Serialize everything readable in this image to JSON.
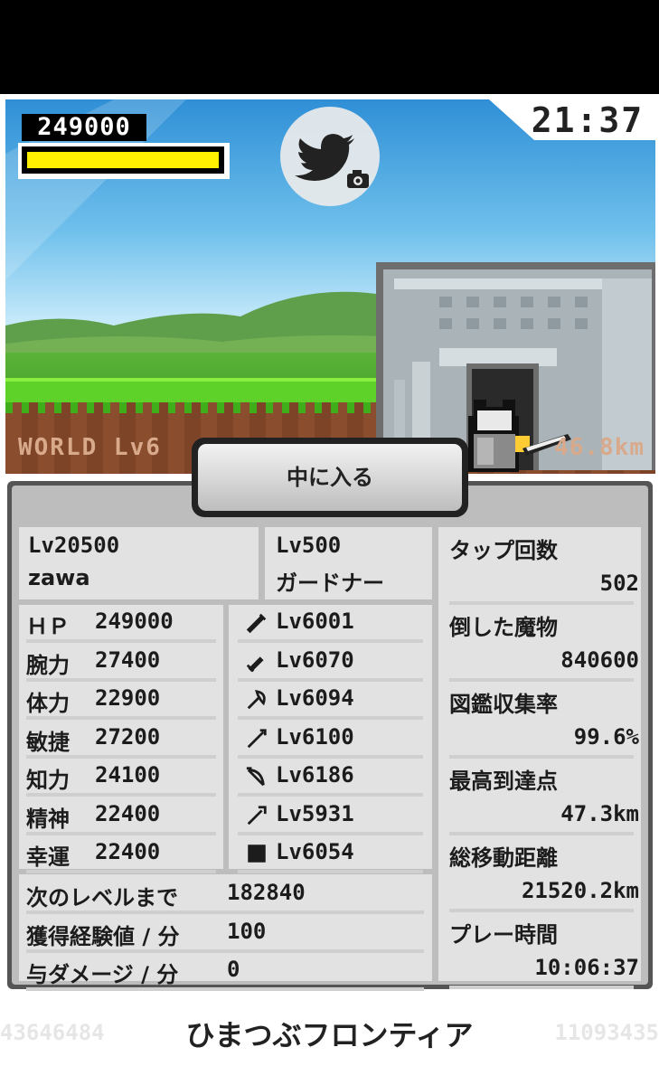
{
  "hud": {
    "score": "249000",
    "hp_fraction": 1.0,
    "clock": "21:37",
    "world_level": "WORLD Lv6",
    "distance": "46.8km",
    "enter_button": "中に入る"
  },
  "player": {
    "level": "Lv20500",
    "name": "zawa"
  },
  "job": {
    "level": "Lv500",
    "name": "ガードナー"
  },
  "stats": [
    {
      "label": "ＨＰ",
      "value": "249000"
    },
    {
      "label": "腕力",
      "value": "27400"
    },
    {
      "label": "体力",
      "value": "22900"
    },
    {
      "label": "敏捷",
      "value": "27200"
    },
    {
      "label": "知力",
      "value": "24100"
    },
    {
      "label": "精神",
      "value": "22400"
    },
    {
      "label": "幸運",
      "value": "22400"
    }
  ],
  "weapons": [
    {
      "icon": "sword-icon",
      "level": "Lv6001"
    },
    {
      "icon": "dagger-icon",
      "level": "Lv6070"
    },
    {
      "icon": "axe-icon",
      "level": "Lv6094"
    },
    {
      "icon": "spear-icon",
      "level": "Lv6100"
    },
    {
      "icon": "bow-icon",
      "level": "Lv6186"
    },
    {
      "icon": "staff-icon",
      "level": "Lv5931"
    },
    {
      "icon": "shield-icon",
      "level": "Lv6054"
    }
  ],
  "progress": [
    {
      "label": "次のレベルまで",
      "value": "182840"
    },
    {
      "label": "獲得経験値 / 分",
      "value": "100"
    },
    {
      "label": "与ダメージ / 分",
      "value": "0"
    }
  ],
  "records": [
    {
      "label": "タップ回数",
      "value": "502"
    },
    {
      "label": "倒した魔物",
      "value": "840600"
    },
    {
      "label": "図鑑収集率",
      "value": "99.6%"
    },
    {
      "label": "最高到達点",
      "value": "47.3km"
    },
    {
      "label": "総移動距離",
      "value": "21520.2km"
    },
    {
      "label": "プレー時間",
      "value": "10:06:37"
    }
  ],
  "footer": {
    "title": "ひまつぶフロンティア",
    "left_number": "43646484",
    "right_number": "11093435"
  },
  "colors": {
    "hp_bar": "#ffef00",
    "panel_bg": "#bdbdbd",
    "cell_bg": "#e2e2e2"
  }
}
